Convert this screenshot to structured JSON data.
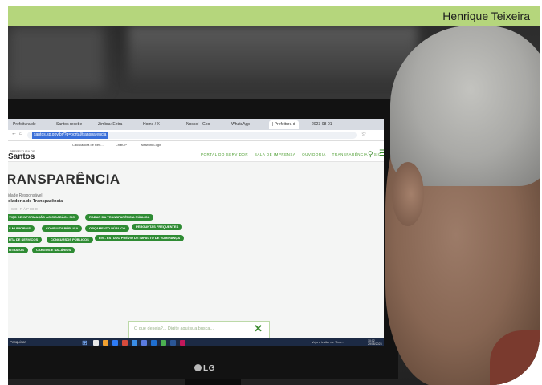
{
  "photo_credit": "Henrique Teixeira",
  "browser": {
    "tabs": [
      {
        "label": "Prefeitura de"
      },
      {
        "label": "Santos recebe"
      },
      {
        "label": "Zimbra: Entra"
      },
      {
        "label": "Home / X"
      },
      {
        "label": "Nosso! - Goo"
      },
      {
        "label": "WhatsApp"
      },
      {
        "label": "| Prefeitura d",
        "active": true
      },
      {
        "label": "2023-08-01"
      }
    ],
    "url": "santos.sp.gov.br/?q=portal/transparencia",
    "bookmarks": [
      "Calculadora de Ren...",
      "ChatGPT",
      "Network Login"
    ]
  },
  "site": {
    "logo_small": "PREFEITURA DE",
    "logo": "Santos",
    "nav": [
      "PORTAL DO SERVIDOR",
      "SALA DE IMPRENSA",
      "OUVIDORIA",
      "TRANSPARÊNCIA",
      "SIC"
    ],
    "page_title": "RANSPARÊNCIA",
    "unit_label": "idade Responsável",
    "unit_value": "oladoria de Transparência",
    "quick_label": "SO RÁPIDO",
    "quick_buttons": [
      "VIÇO DE INFORMAÇÃO AO CIDADÃO - SIC",
      "RADAR DA TRANSPARÊNCIA PÚBLICA",
      "S MUNICIPAIS",
      "CONSULTA PÚBLICA",
      "ORÇAMENTO PÚBLICO",
      "PERGUNTAS FREQUENTES",
      "RTA DE SERVIÇOS",
      "CONCURSOS PÚBLICOS",
      "EIV - ESTUDO PRÉVIO DE IMPACTO DE VIZINHANÇA",
      "NTRATOS",
      "CARGOS E SALÁRIOS"
    ],
    "search_placeholder": "O que deseja?... Digite aqui sua busca...",
    "colors": {
      "primary_green": "#2e8b33",
      "nav_green": "#4a9c2e"
    }
  },
  "taskbar": {
    "search": "Pesquisar",
    "video": "Veja o trailer de 'Con...",
    "time": "10:02",
    "date": "29/08/2023"
  },
  "monitor_brand": "LG"
}
